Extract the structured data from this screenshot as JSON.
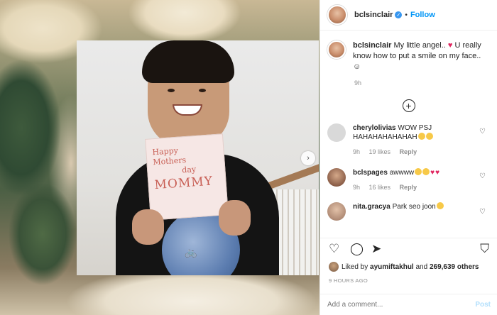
{
  "header": {
    "username": "bclsinclair",
    "verified_icon": "verified-badge-icon",
    "separator": "•",
    "follow_label": "Follow"
  },
  "caption": {
    "username": "bclsinclair",
    "text_before_heart": "My little angel..",
    "heart": "♥",
    "text_after_heart": "U really know how to put a smile on my face.. ☺",
    "time": "9h"
  },
  "load_more_icon": "⊕",
  "comments": [
    {
      "username": "cherylolivias",
      "text": "WOW PSJ HAHAHAHAHAHAH",
      "emoji": [
        "😁",
        "😂"
      ],
      "time": "9h",
      "likes": "19 likes",
      "reply": "Reply"
    },
    {
      "username": "bclspages",
      "text": "awwww",
      "emoji": [
        "😔",
        "😔",
        "♥",
        "♥"
      ],
      "time": "9h",
      "likes": "16 likes",
      "reply": "Reply"
    },
    {
      "username": "nita.gracya",
      "text": "Park seo joon",
      "emoji": [
        "😂"
      ],
      "time": "",
      "likes": "",
      "reply": ""
    }
  ],
  "actions": {
    "like_icon": "heart-outline-icon",
    "comment_icon": "comment-icon",
    "share_icon": "share-icon",
    "save_icon": "bookmark-icon"
  },
  "likes": {
    "prefix": "Liked by",
    "user": "ayumiftakhul",
    "and": "and",
    "count": "269,639 others"
  },
  "time_ago": "9 HOURS AGO",
  "add_comment": {
    "placeholder": "Add a comment...",
    "post_label": "Post"
  },
  "card": {
    "line1": "Happy",
    "line2": "Mothers",
    "line3": "day",
    "line4": "MOMMY"
  },
  "colors": {
    "accent": "#0095f6",
    "heart": "#e0245e",
    "verified": "#3897f0"
  }
}
